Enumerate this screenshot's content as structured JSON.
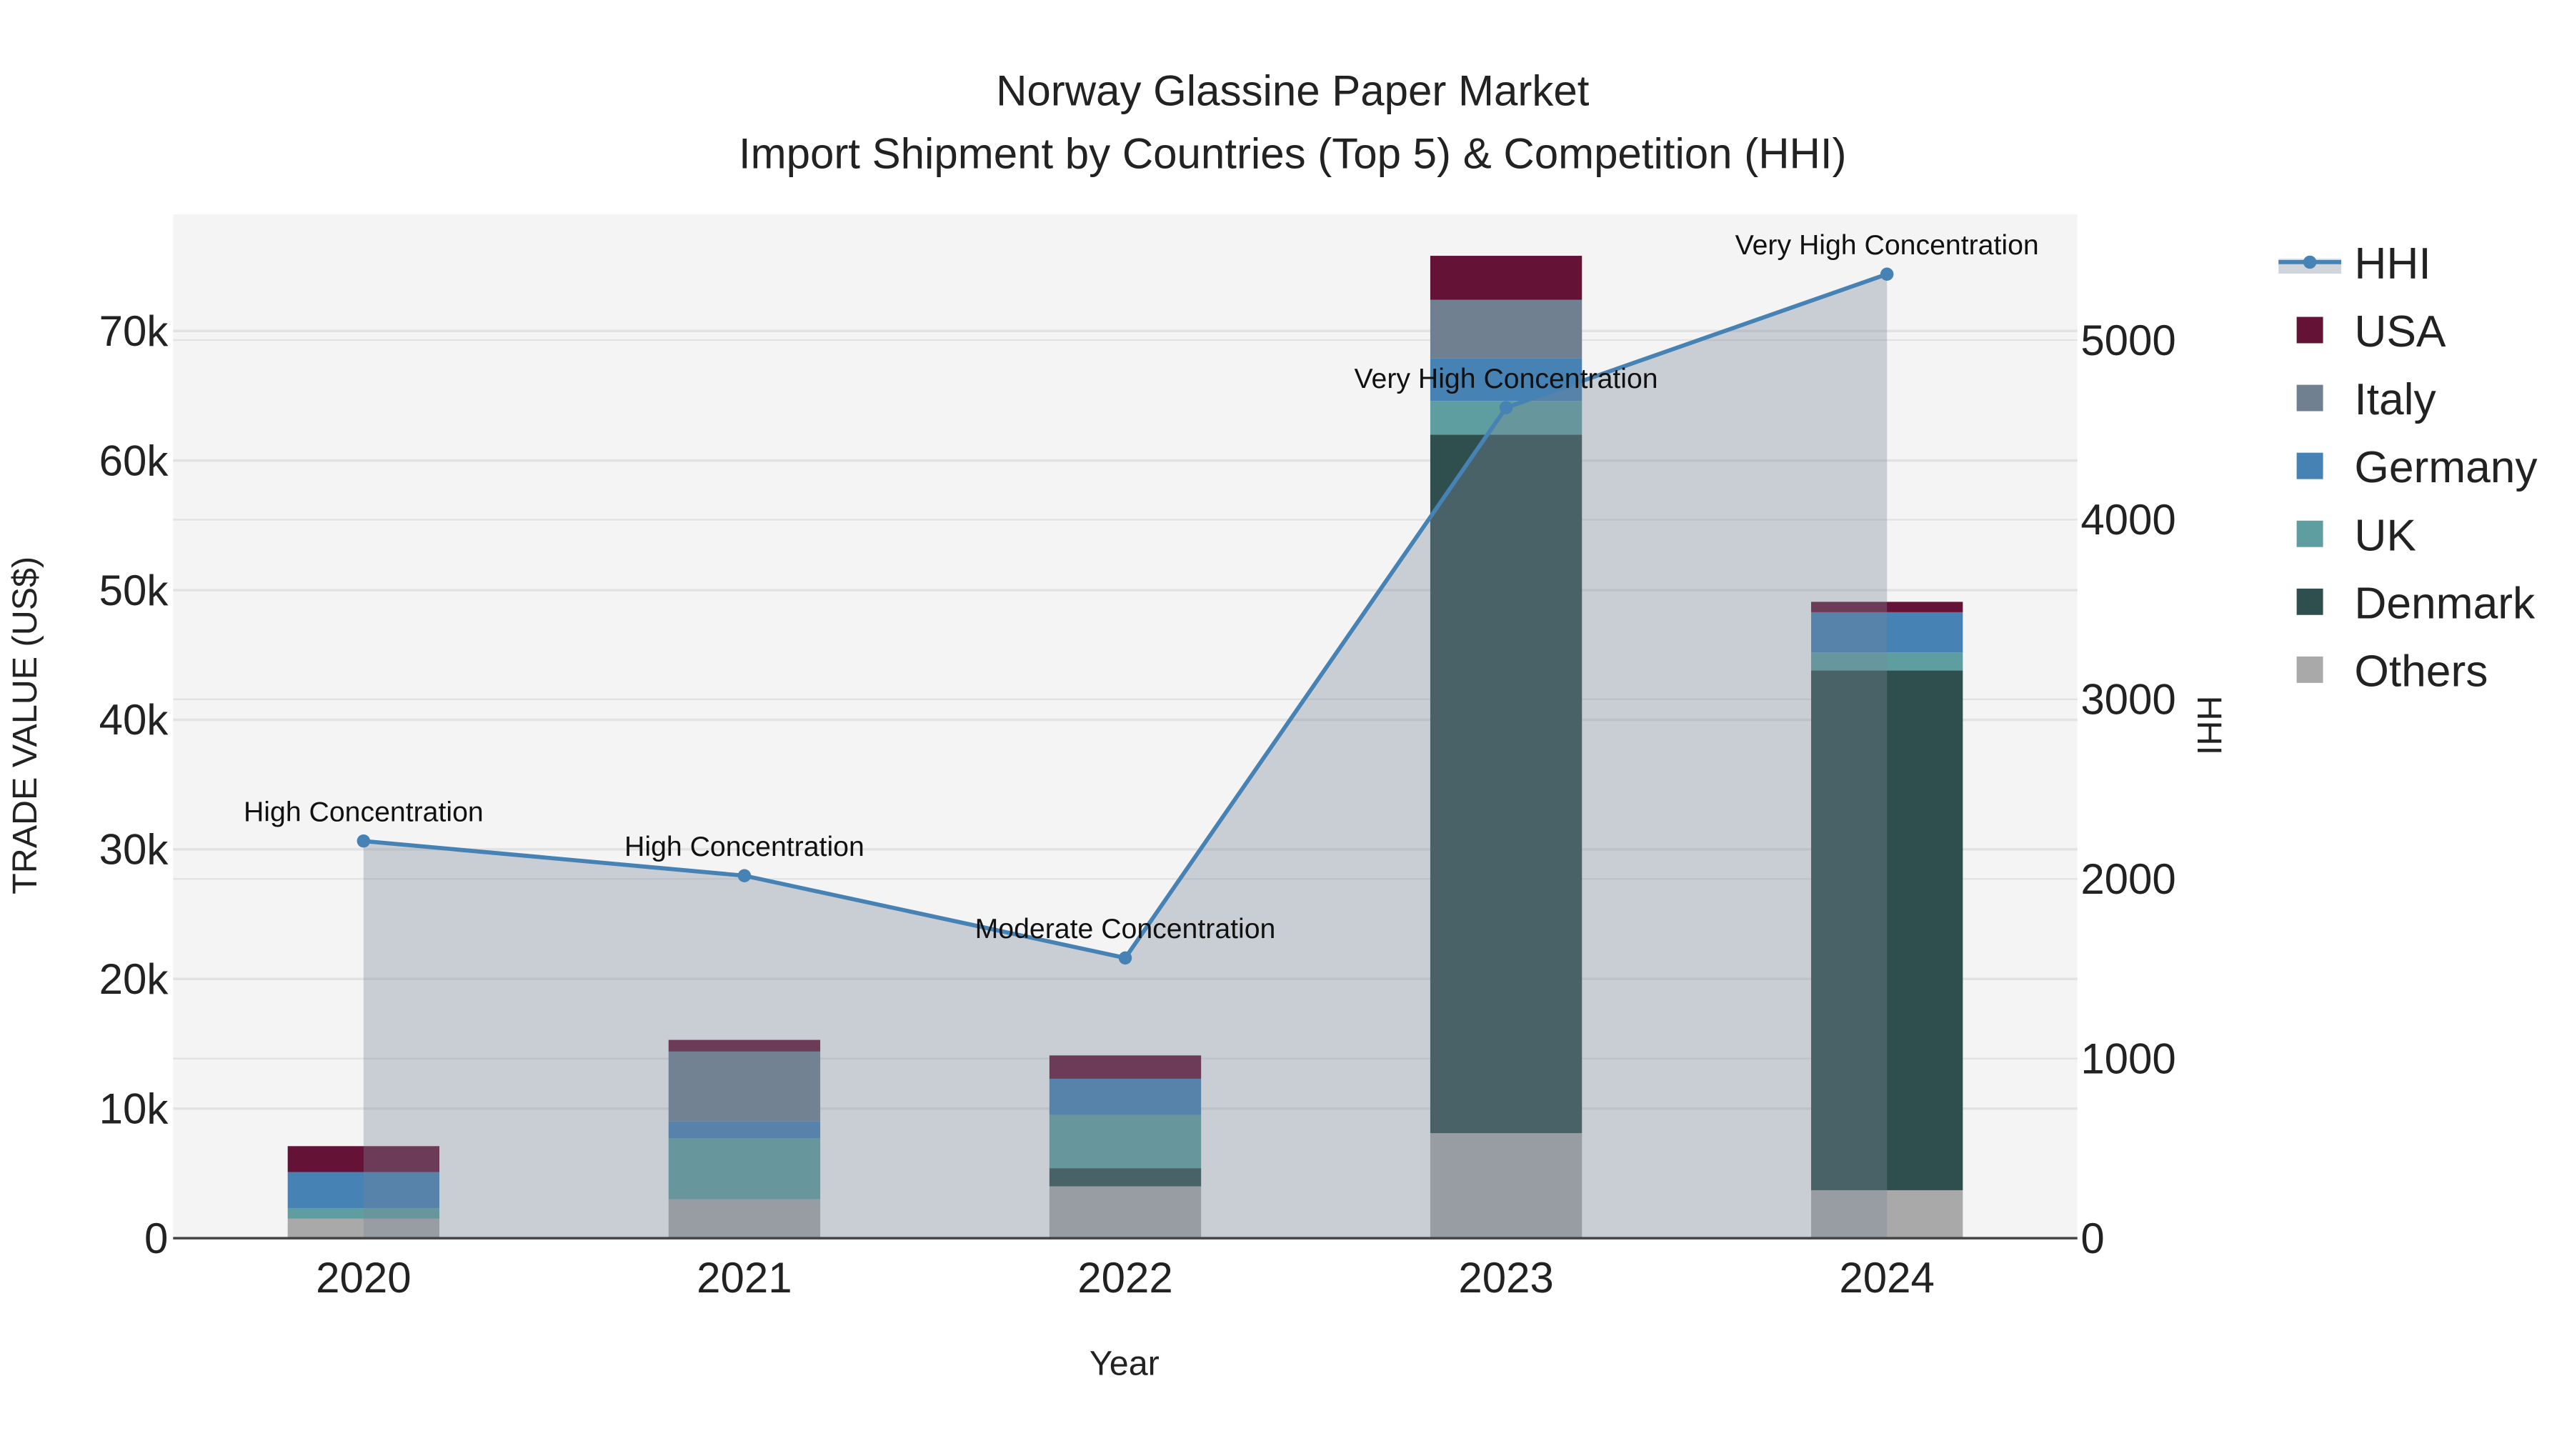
{
  "chart_data": {
    "type": "bar",
    "title": "Norway Glassine Paper Market",
    "subtitle": "Import Shipment by Countries (Top 5) & Competition (HHI)",
    "xlabel": "Year",
    "ylabel": "TRADE VALUE (US$)",
    "y2label": "HHI",
    "categories": [
      "2020",
      "2021",
      "2022",
      "2023",
      "2024"
    ],
    "ylim": [
      0,
      79000
    ],
    "y_ticks": [
      0,
      10000,
      20000,
      30000,
      40000,
      50000,
      60000,
      70000
    ],
    "y_tick_labels": [
      "0",
      "10k",
      "20k",
      "30k",
      "40k",
      "50k",
      "60k",
      "70k"
    ],
    "y2lim": [
      0,
      5700
    ],
    "y2_ticks": [
      0,
      1000,
      2000,
      3000,
      4000,
      5000
    ],
    "y2_tick_labels": [
      "0",
      "1000",
      "2000",
      "3000",
      "4000",
      "5000"
    ],
    "grid": true,
    "legend_placement": "right",
    "series": [
      {
        "name": "Others",
        "color": "#A9A9A9",
        "values": [
          1500,
          3000,
          4000,
          8100,
          3700
        ]
      },
      {
        "name": "Denmark",
        "color": "#2F4F4F",
        "values": [
          0,
          0,
          1400,
          53900,
          40100
        ]
      },
      {
        "name": "UK",
        "color": "#5F9EA0",
        "values": [
          800,
          4700,
          4100,
          2600,
          1400
        ]
      },
      {
        "name": "Germany",
        "color": "#4682B4",
        "values": [
          2800,
          1300,
          2800,
          3300,
          3100
        ]
      },
      {
        "name": "Italy",
        "color": "#708090",
        "values": [
          0,
          5400,
          0,
          4500,
          0
        ]
      },
      {
        "name": "USA",
        "color": "#641336",
        "values": [
          2000,
          900,
          1800,
          3400,
          800
        ]
      }
    ],
    "hhi": {
      "name": "HHI",
      "color": "#4682B4",
      "values": [
        2211,
        2018,
        1560,
        4624,
        5367
      ],
      "annotations": [
        "High Concentration",
        "High Concentration",
        "Moderate Concentration",
        "Very High Concentration",
        "Very High Concentration"
      ]
    },
    "legend": [
      "HHI",
      "USA",
      "Italy",
      "Germany",
      "UK",
      "Denmark",
      "Others"
    ]
  }
}
